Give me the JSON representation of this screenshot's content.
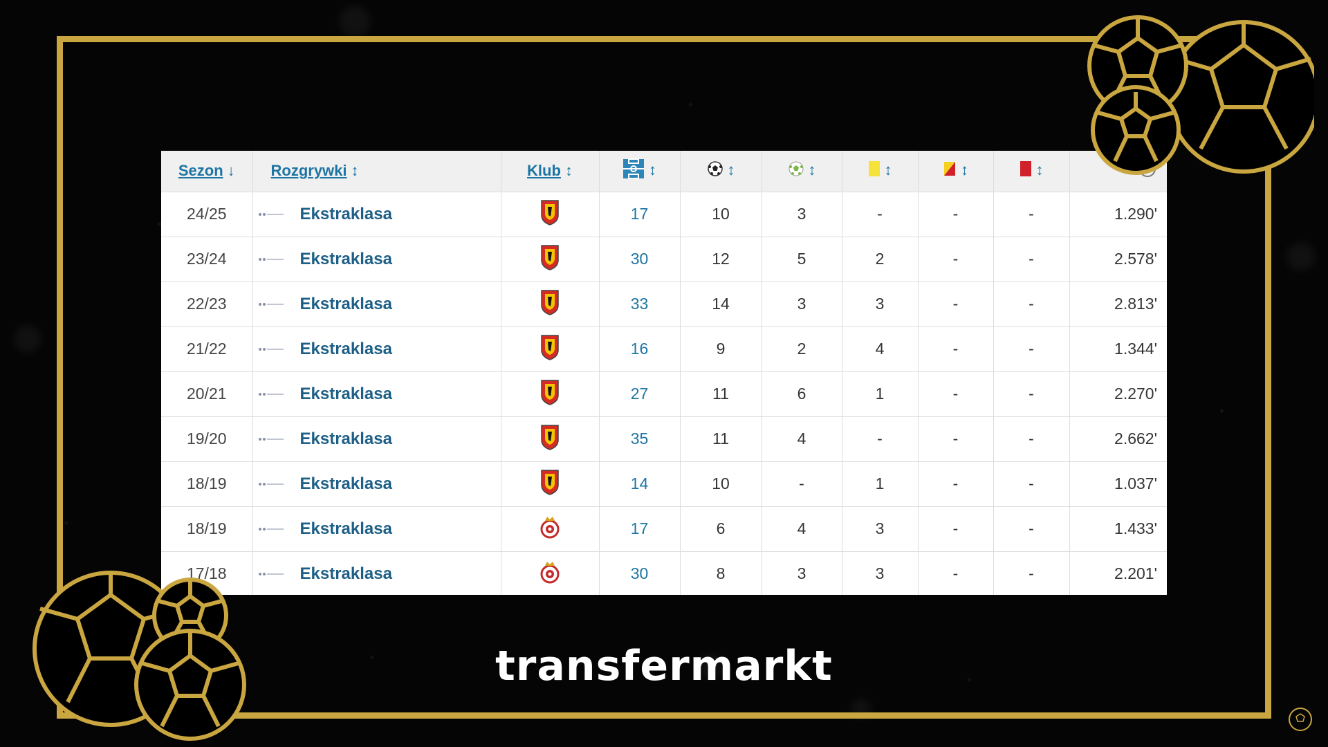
{
  "colors": {
    "gold": "#c9a640",
    "link_blue": "#1d75a3",
    "comp_blue": "#1d5f86",
    "header_bg": "#f0f0f0"
  },
  "table": {
    "headers": {
      "season": "Sezon",
      "competition": "Rozgrywki",
      "club": "Klub",
      "appearances_icon": "pitch-icon",
      "goals_icon": "ball-icon",
      "assists_icon": "assist-ball-icon",
      "yellow_icon": "yellow-card-icon",
      "second_yellow_icon": "yellow-red-card-icon",
      "red_icon": "red-card-icon",
      "minutes_icon": "clock-icon",
      "sort_desc": "↓",
      "sort_both": "↕"
    },
    "rows": [
      {
        "season": "24/25",
        "competition": "Ekstraklasa",
        "club": "jagiellonia-crest",
        "apps": "17",
        "goals": "10",
        "assists": "3",
        "yellow": "-",
        "second_yellow": "-",
        "red": "-",
        "minutes": "1.290'"
      },
      {
        "season": "23/24",
        "competition": "Ekstraklasa",
        "club": "jagiellonia-crest",
        "apps": "30",
        "goals": "12",
        "assists": "5",
        "yellow": "2",
        "second_yellow": "-",
        "red": "-",
        "minutes": "2.578'"
      },
      {
        "season": "22/23",
        "competition": "Ekstraklasa",
        "club": "jagiellonia-crest",
        "apps": "33",
        "goals": "14",
        "assists": "3",
        "yellow": "3",
        "second_yellow": "-",
        "red": "-",
        "minutes": "2.813'"
      },
      {
        "season": "21/22",
        "competition": "Ekstraklasa",
        "club": "jagiellonia-crest",
        "apps": "16",
        "goals": "9",
        "assists": "2",
        "yellow": "4",
        "second_yellow": "-",
        "red": "-",
        "minutes": "1.344'"
      },
      {
        "season": "20/21",
        "competition": "Ekstraklasa",
        "club": "jagiellonia-crest",
        "apps": "27",
        "goals": "11",
        "assists": "6",
        "yellow": "1",
        "second_yellow": "-",
        "red": "-",
        "minutes": "2.270'"
      },
      {
        "season": "19/20",
        "competition": "Ekstraklasa",
        "club": "jagiellonia-crest",
        "apps": "35",
        "goals": "11",
        "assists": "4",
        "yellow": "-",
        "second_yellow": "-",
        "red": "-",
        "minutes": "2.662'"
      },
      {
        "season": "18/19",
        "competition": "Ekstraklasa",
        "club": "jagiellonia-crest",
        "apps": "14",
        "goals": "10",
        "assists": "-",
        "yellow": "1",
        "second_yellow": "-",
        "red": "-",
        "minutes": "1.037'"
      },
      {
        "season": "18/19",
        "competition": "Ekstraklasa",
        "club": "wisla-crest",
        "apps": "17",
        "goals": "6",
        "assists": "4",
        "yellow": "3",
        "second_yellow": "-",
        "red": "-",
        "minutes": "1.433'"
      },
      {
        "season": "17/18",
        "competition": "Ekstraklasa",
        "club": "wisla-crest",
        "apps": "30",
        "goals": "8",
        "assists": "3",
        "yellow": "3",
        "second_yellow": "-",
        "red": "-",
        "minutes": "2.201'"
      }
    ]
  },
  "caption": "transfermarkt",
  "decorations": {
    "ball_icon": "football-outline-icon",
    "corner_logo": "channel-logo-icon"
  }
}
